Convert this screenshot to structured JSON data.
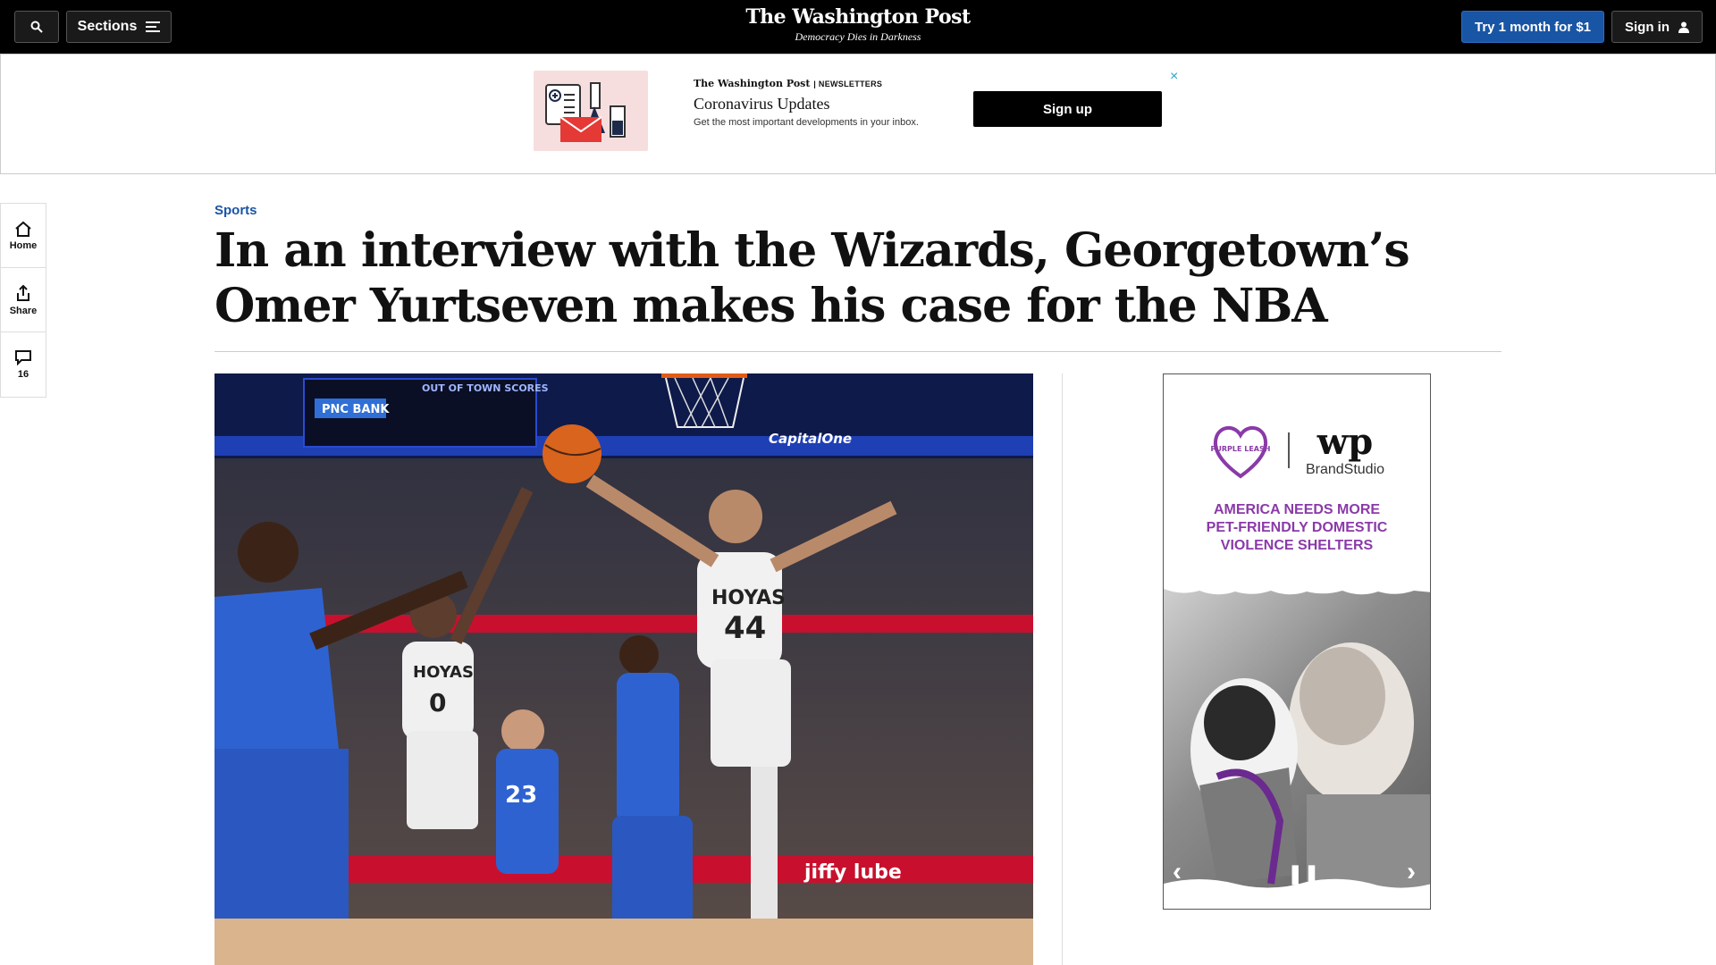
{
  "topbar": {
    "sections_label": "Sections",
    "logo": "The Washington Post",
    "tagline": "Democracy Dies in Darkness",
    "subscribe_label": "Try 1 month for $1",
    "signin_label": "Sign in"
  },
  "newsletter": {
    "brand": "The Washington Post",
    "brand_suffix": "| NEWSLETTERS",
    "title": "Coronavirus Updates",
    "description": "Get the most important developments in your inbox.",
    "signup_label": "Sign up",
    "close": "×"
  },
  "rail": {
    "home_label": "Home",
    "share_label": "Share",
    "comments_count": "16"
  },
  "article": {
    "kicker": "Sports",
    "headline": "In an interview with the Wizards, Georgetown’s Omer Yurtseven makes his case for the NBA"
  },
  "photo": {
    "scoreboard": "OUT OF TOWN SCORES",
    "sponsor_pnc": "PNC BANK",
    "sponsor_capital": "CapitalOne",
    "jersey_44": "44",
    "jersey_0": "0",
    "jersey_23": "23",
    "team": "HOYAS",
    "court_ad": "jiffy lube"
  },
  "ad": {
    "partner": "PURPLE LEASH",
    "wp_mark": "wp",
    "brand_studio": "BrandStudio",
    "headline_line1": "AMERICA NEEDS MORE",
    "headline_line2": "PET-FRIENDLY DOMESTIC",
    "headline_line3": "VIOLENCE SHELTERS"
  },
  "colors": {
    "kicker_blue": "#1955a5",
    "subscribe_blue": "#1955a5",
    "ad_purple": "#8a3aa8"
  }
}
